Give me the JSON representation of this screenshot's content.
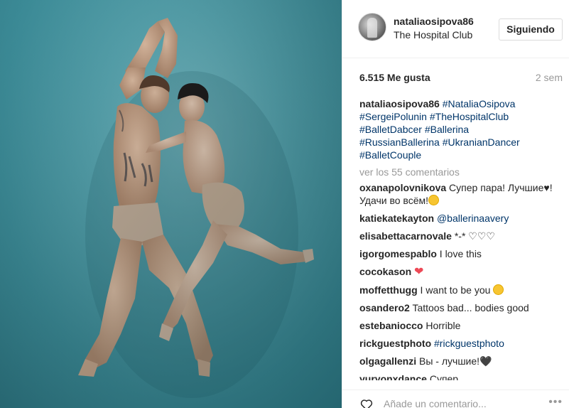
{
  "post": {
    "username": "nataliaosipova86",
    "location": "The Hospital Club",
    "follow_label": "Siguiendo",
    "likes": "6.515 Me gusta",
    "age": "2 sem",
    "photo_alt": "photo"
  },
  "caption": {
    "user": "nataliaosipova86",
    "tags": [
      "#NataliaOsipova",
      "#SergeiPolunin",
      "#TheHospitalClub",
      "#BalletDabcer",
      "#Ballerina",
      "#RussianBallerina",
      "#UkranianDancer",
      "#BalletCouple"
    ]
  },
  "view_all": "ver los 55 comentarios",
  "comments": [
    {
      "user": "oxanapolovnikova",
      "text": "Супер пара! Лучшие",
      "text2": "! Удачи во всём!"
    },
    {
      "user": "katiekatekayton",
      "mention": "@ballerinaavery"
    },
    {
      "user": "elisabettacarnovale",
      "text": "*-* ♡♡♡"
    },
    {
      "user": "igorgomespablo",
      "text": "I love this"
    },
    {
      "user": "cocokason",
      "text": "❤"
    },
    {
      "user": "moffetthugg",
      "text": "I want to be you"
    },
    {
      "user": "osandero2",
      "text": "Tattoos bad... bodies good"
    },
    {
      "user": "estebaniocco",
      "text": "Horrible"
    },
    {
      "user": "rickguestphoto",
      "mention": "#rickguestphoto"
    },
    {
      "user": "olgagallenzi",
      "text": "Вы - лучшие!",
      "text2": "🖤"
    },
    {
      "user": "yuryonxdance",
      "text": "Супер"
    }
  ],
  "add_comment": {
    "placeholder": "Añade un comentario...",
    "more": "•••"
  },
  "colors": {
    "link": "#003569",
    "muted": "#999999",
    "text": "#262626",
    "heart": "#ed4956"
  }
}
